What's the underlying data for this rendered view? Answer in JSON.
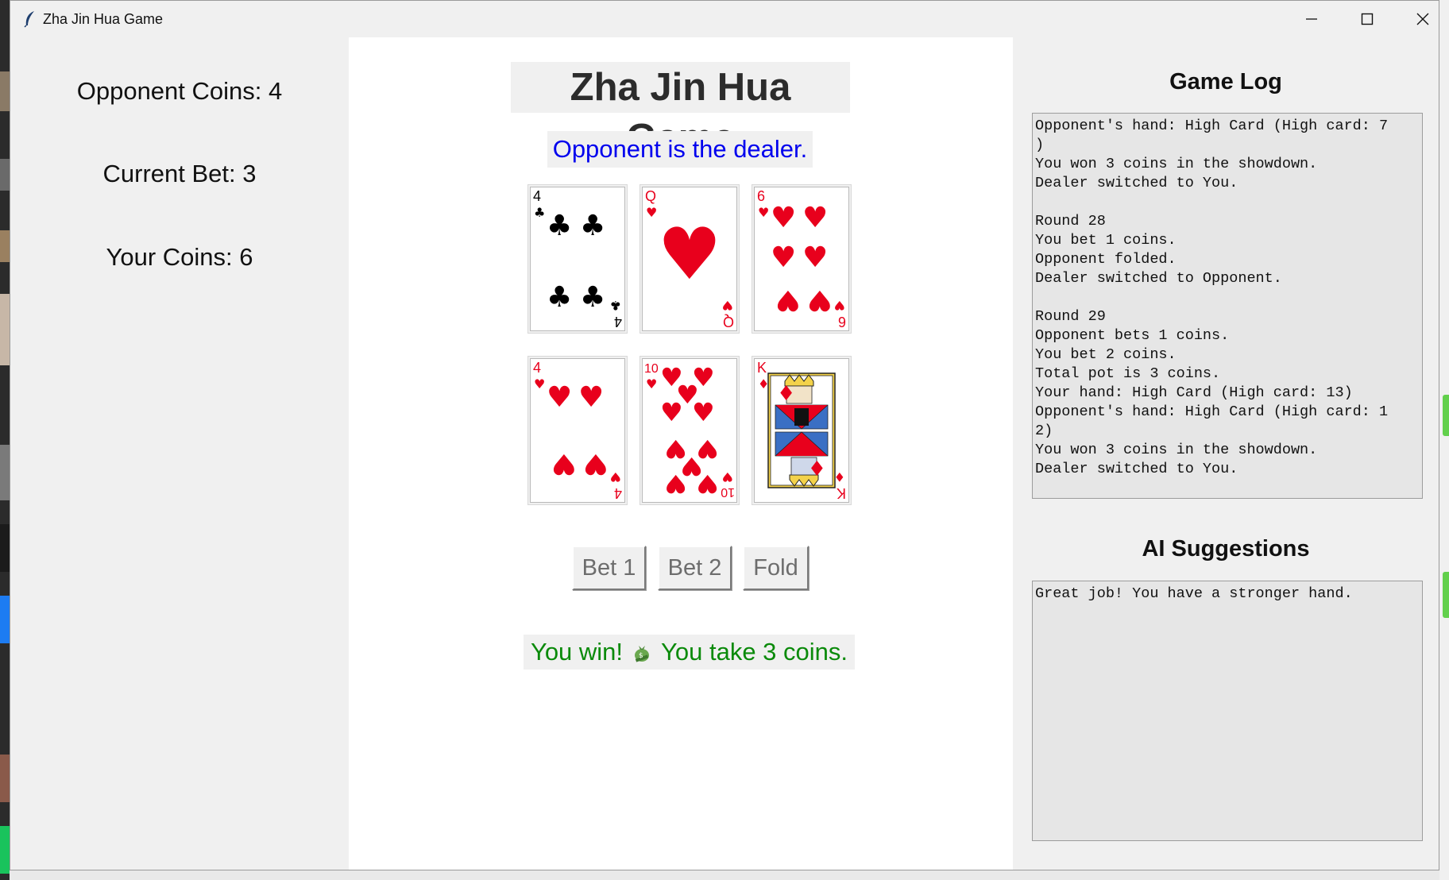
{
  "window": {
    "title": "Zha Jin Hua Game",
    "controls": [
      "minimize",
      "maximize",
      "close"
    ]
  },
  "left_panel": {
    "opponent_coins": "Opponent Coins: 4",
    "current_bet": "Current Bet: 3",
    "your_coins": "Your Coins: 6"
  },
  "center_panel": {
    "title": "Zha Jin Hua Game",
    "dealer_status": "Opponent is the dealer.",
    "opponent_cards": [
      {
        "rank": "4",
        "suit": "clubs"
      },
      {
        "rank": "Q",
        "suit": "hearts"
      },
      {
        "rank": "6",
        "suit": "hearts"
      }
    ],
    "player_cards": [
      {
        "rank": "4",
        "suit": "hearts"
      },
      {
        "rank": "10",
        "suit": "hearts"
      },
      {
        "rank": "K",
        "suit": "diamonds"
      }
    ],
    "buttons": {
      "bet1": "Bet 1",
      "bet2": "Bet 2",
      "fold": "Fold"
    },
    "result_text_1": "You win!",
    "result_icon": "money-bag-icon",
    "result_text_2": "You take 3 coins."
  },
  "right_panel": {
    "game_log_title": "Game Log",
    "game_log_text": "Opponent's hand: High Card (High card: 7\n)\nYou won 3 coins in the showdown.\nDealer switched to You.\n\nRound 28\nYou bet 1 coins.\nOpponent folded.\nDealer switched to Opponent.\n\nRound 29\nOpponent bets 1 coins.\nYou bet 2 coins.\nTotal pot is 3 coins.\nYour hand: High Card (High card: 13)\nOpponent's hand: High Card (High card: 1\n2)\nYou won 3 coins in the showdown.\nDealer switched to You.",
    "ai_title": "AI Suggestions",
    "ai_text": "Great job! You have a stronger hand."
  },
  "colors": {
    "dealer_text": "#0000ee",
    "result_text": "#0a8a0a",
    "hearts": "#e8001c",
    "clubs": "#000000"
  }
}
